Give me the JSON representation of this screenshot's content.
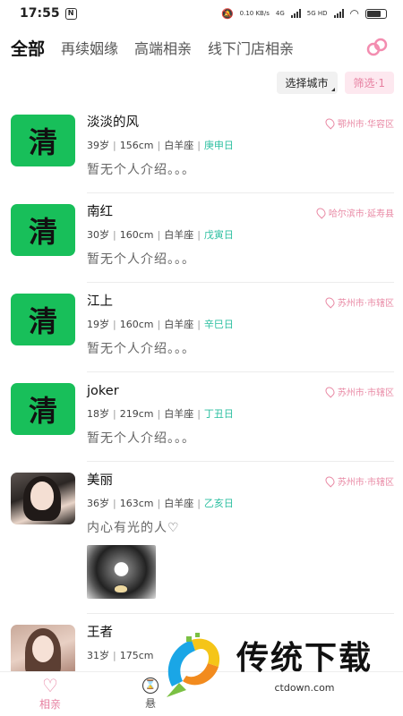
{
  "status": {
    "time": "17:55",
    "speed": "0.10 KB/s",
    "signal1": "4G",
    "signal2": "5G HD"
  },
  "tabs": [
    {
      "label": "全部",
      "active": true
    },
    {
      "label": "再续姻缘",
      "active": false
    },
    {
      "label": "高端相亲",
      "active": false
    },
    {
      "label": "线下门店相亲",
      "active": false
    }
  ],
  "filters": {
    "city_label": "选择城市",
    "filter_label": "筛选·1"
  },
  "users": [
    {
      "name": "淡淡的风",
      "age": "39岁",
      "height": "156cm",
      "sign": "白羊座",
      "day": "庚申日",
      "location": "鄂州市·华容区",
      "bio": "暂无个人介绍。。。",
      "avatar": "qing",
      "avatar_text": "清"
    },
    {
      "name": "南红",
      "age": "30岁",
      "height": "160cm",
      "sign": "白羊座",
      "day": "戊寅日",
      "location": "哈尔滨市·延寿县",
      "bio": "暂无个人介绍。。。",
      "avatar": "qing",
      "avatar_text": "清"
    },
    {
      "name": "江上",
      "age": "19岁",
      "height": "160cm",
      "sign": "白羊座",
      "day": "辛巳日",
      "location": "苏州市·市辖区",
      "bio": "暂无个人介绍。。。",
      "avatar": "qing",
      "avatar_text": "清"
    },
    {
      "name": "joker",
      "age": "18岁",
      "height": "219cm",
      "sign": "白羊座",
      "day": "丁丑日",
      "location": "苏州市·市辖区",
      "bio": "暂无个人介绍。。。",
      "avatar": "qing",
      "avatar_text": "清"
    },
    {
      "name": "美丽",
      "age": "36岁",
      "height": "163cm",
      "sign": "白羊座",
      "day": "乙亥日",
      "location": "苏州市·市辖区",
      "bio": "内心有光的人♡",
      "avatar": "photo",
      "avatar_text": ""
    },
    {
      "name": "王者",
      "age": "31岁",
      "height": "175cm",
      "sign": "",
      "day": "",
      "location": "",
      "bio": "",
      "avatar": "photo2",
      "avatar_text": ""
    }
  ],
  "bottom_tabs": [
    {
      "label": "相亲",
      "icon": "heart-icon",
      "active": true
    },
    {
      "label": "悬",
      "icon": "clock-icon",
      "active": false
    }
  ],
  "watermark": {
    "title": "传统下载",
    "url": "ctdown.com"
  },
  "colors": {
    "accent": "#e77fa0",
    "avatar_green": "#18bf5a",
    "day_teal": "#2bbfa0"
  }
}
